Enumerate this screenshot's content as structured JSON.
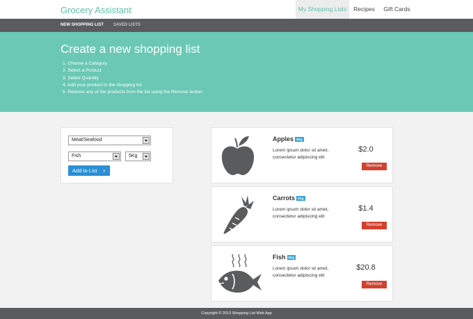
{
  "brand": "Grocery Assistant",
  "topnav": [
    {
      "label": "My Shopping Lists",
      "active": true
    },
    {
      "label": "Recipes",
      "active": false
    },
    {
      "label": "Gift Cards",
      "active": false
    }
  ],
  "subnav": [
    {
      "label": "NEW SHOPPING LIST",
      "active": true
    },
    {
      "label": "SAVED LISTS",
      "active": false
    }
  ],
  "hero": {
    "title": "Create a new shopping list",
    "steps": [
      "1.  Choose a Category",
      "2.  Select a Product",
      "3.  Select Quantity",
      "4.  Add your product to the shopping list",
      "5.  Remove any of the products from the list using the Remove button"
    ]
  },
  "form": {
    "category": "Meat/Seafood",
    "product": "Fish",
    "quantity": "5Kg",
    "add_label": "Add to List"
  },
  "products": [
    {
      "name": "Apples",
      "qty": "2Kg",
      "description": "Lorem ipsum dolor sit amet, consectetur adipiscing elit",
      "price": "$2.0",
      "remove_label": "Remove",
      "icon": "apple-icon"
    },
    {
      "name": "Carrots",
      "qty": "2Kg",
      "description": "Lorem ipsum dolor sit amet, consectetur adipiscing elit",
      "price": "$1.4",
      "remove_label": "Remove",
      "icon": "carrot-icon"
    },
    {
      "name": "Fish",
      "qty": "5Kg",
      "description": "Lorem ipsum dolor sit amet, consectetur adipiscing elit",
      "price": "$20.8",
      "remove_label": "Remove",
      "icon": "fish-icon"
    }
  ],
  "footer": "Copyright © 2013 Shopping List Web App",
  "colors": {
    "accent": "#6ac8b4",
    "brand_text": "#5bc0a8",
    "dark_bar": "#595b5d",
    "primary_button": "#2a8fd4",
    "danger_button": "#d2412f",
    "badge": "#3aa3d6",
    "icon_fill": "#595b5d"
  }
}
